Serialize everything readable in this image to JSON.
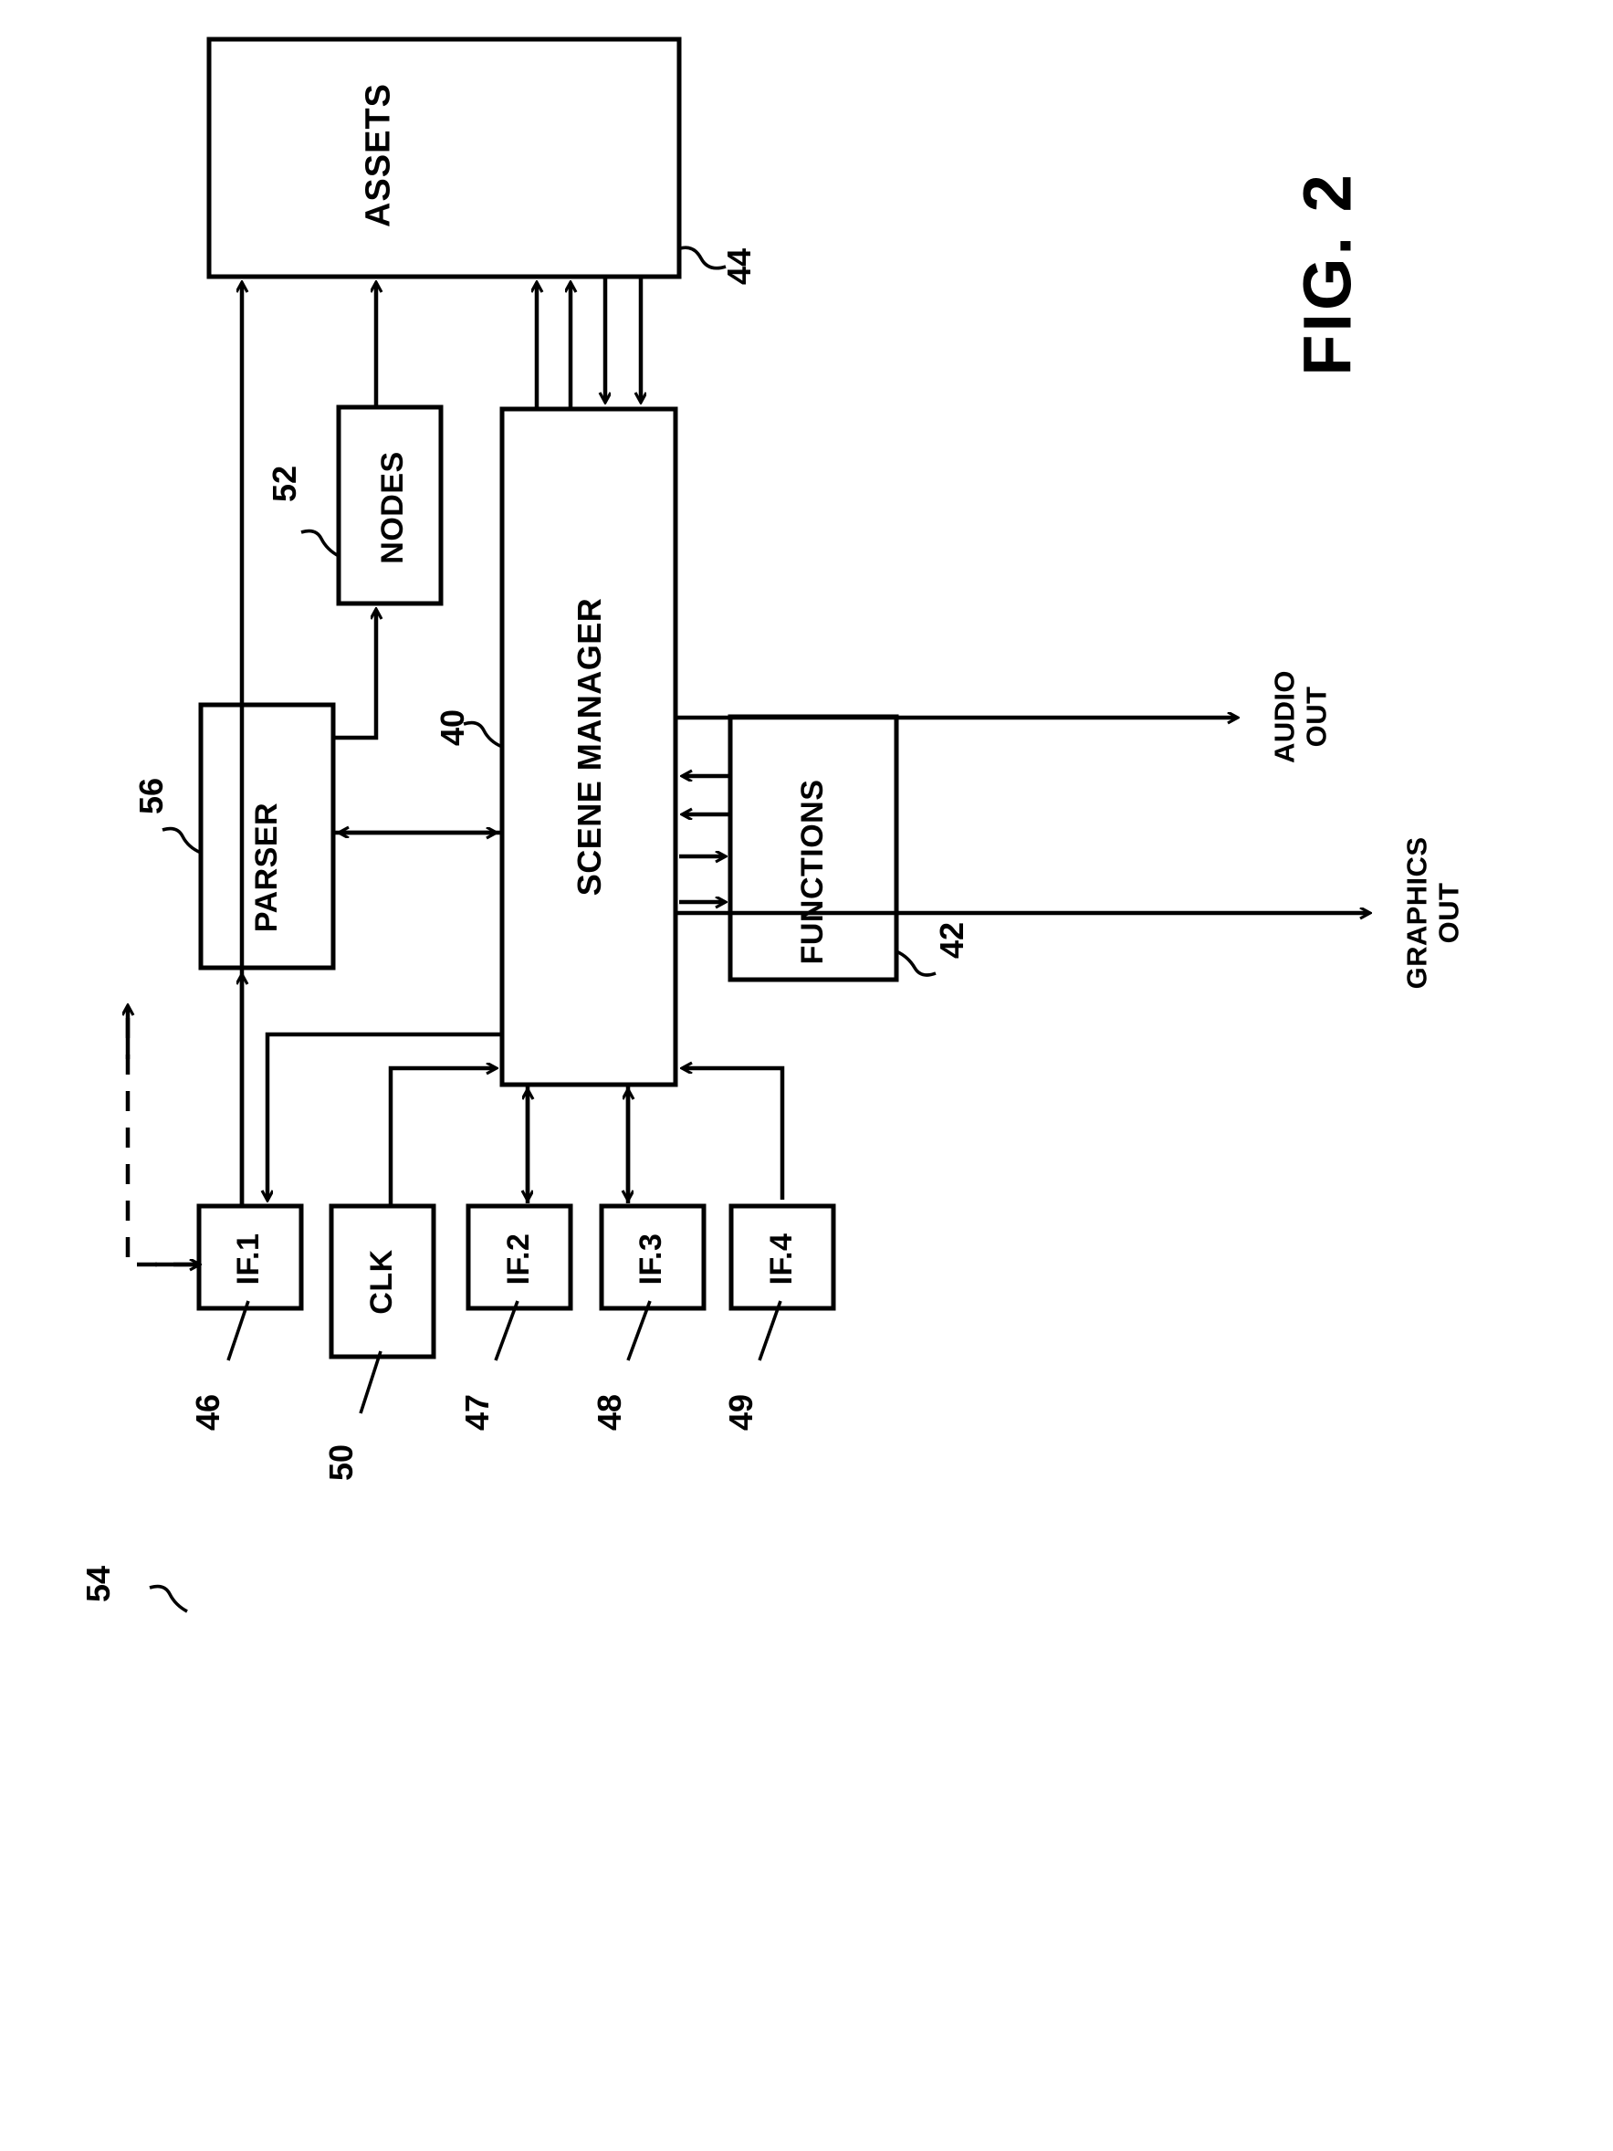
{
  "figure": {
    "title": "FIG. 2",
    "orientation": "landscape-rotated-90"
  },
  "blocks": [
    {
      "id": "assets",
      "label": "ASSETS",
      "ref": "44"
    },
    {
      "id": "nodes",
      "label": "NODES",
      "ref": "52"
    },
    {
      "id": "scene_manager",
      "label": "SCENE MANAGER",
      "ref": "40"
    },
    {
      "id": "parser",
      "label": "PARSER",
      "ref": "56"
    },
    {
      "id": "functions",
      "label": "FUNCTIONS",
      "ref": "42"
    },
    {
      "id": "if1",
      "label": "IF.1",
      "ref": "46"
    },
    {
      "id": "clk",
      "label": "CLK",
      "ref": "50"
    },
    {
      "id": "if2",
      "label": "IF.2",
      "ref": "47"
    },
    {
      "id": "if3",
      "label": "IF.3",
      "ref": "48"
    },
    {
      "id": "if4",
      "label": "IF.4",
      "ref": "49"
    }
  ],
  "outputs": [
    {
      "id": "audio_out",
      "line1": "AUDIO",
      "line2": "OUT"
    },
    {
      "id": "graphics_out",
      "line1": "GRAPHICS",
      "line2": "OUT"
    }
  ],
  "annotations": [
    {
      "id": "external_input",
      "ref": "54",
      "style": "dashed-arrow"
    }
  ],
  "colors": {
    "ink": "#000000",
    "paper": "#ffffff"
  }
}
